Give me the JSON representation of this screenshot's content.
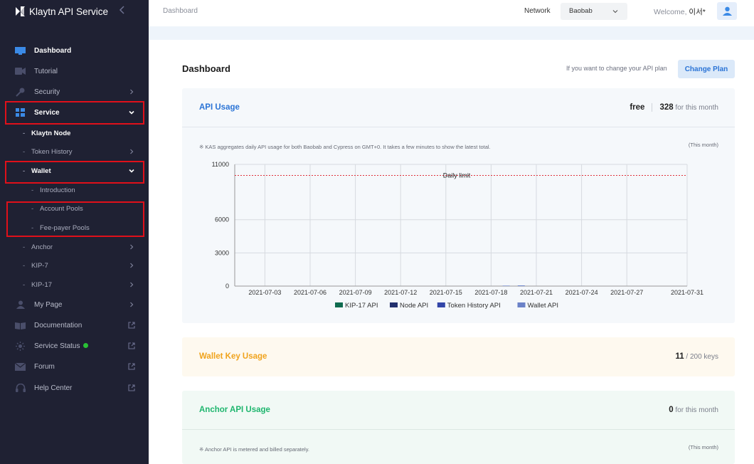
{
  "sidebar": {
    "brand": "Klaytn API Service",
    "items": [
      {
        "label": "Dashboard",
        "icon": "dashboard-icon"
      },
      {
        "label": "Tutorial",
        "icon": "video-icon"
      },
      {
        "label": "Security",
        "icon": "key-icon"
      },
      {
        "label": "Service",
        "icon": "grid-icon"
      },
      {
        "label": "My Page",
        "icon": "user-icon"
      },
      {
        "label": "Documentation",
        "icon": "book-icon"
      },
      {
        "label": "Service Status",
        "icon": "status-icon"
      },
      {
        "label": "Forum",
        "icon": "mail-icon"
      },
      {
        "label": "Help Center",
        "icon": "headset-icon"
      }
    ],
    "service_items": [
      {
        "label": "Klaytn Node"
      },
      {
        "label": "Token History"
      },
      {
        "label": "Wallet"
      },
      {
        "label": "Introduction"
      },
      {
        "label": "Account Pools"
      },
      {
        "label": "Fee-payer Pools"
      },
      {
        "label": "Anchor"
      },
      {
        "label": "KIP-7"
      },
      {
        "label": "KIP-17"
      }
    ],
    "status_color": "#29c135",
    "highlight_color": "#e0101a"
  },
  "topbar": {
    "breadcrumb": "Dashboard",
    "network_label": "Network",
    "network_value": "Baobab",
    "welcome_prefix": "Welcome,",
    "user_name": "이서*"
  },
  "main": {
    "title": "Dashboard",
    "plan_hint": "If you want to change your API plan",
    "change_plan": "Change Plan",
    "api_usage": {
      "title": "API Usage",
      "plan": "free",
      "count": "328",
      "count_suffix": "for this month",
      "note": "※ KAS aggregates daily API usage for both Baobab and Cypress on GMT+0. It takes a few minutes to show the latest total.",
      "period": "(This month)"
    },
    "wallet_key_usage": {
      "title": "Wallet Key Usage",
      "count": "11",
      "suffix": "/ 200 keys"
    },
    "anchor_api_usage": {
      "title": "Anchor API Usage",
      "count": "0",
      "suffix": "for this month",
      "note": "※ Anchor API is metered and billed separately.",
      "period": "(This month)"
    },
    "colors": {
      "api_title": "#2b74d6",
      "wallet_title": "#f0a31c",
      "anchor_title": "#1eb66e"
    }
  },
  "chart_data": {
    "type": "bar",
    "x": [
      "2021-07-03",
      "2021-07-06",
      "2021-07-09",
      "2021-07-12",
      "2021-07-15",
      "2021-07-18",
      "2021-07-21",
      "2021-07-24",
      "2021-07-27",
      "2021-07-31"
    ],
    "xlim": [
      "2021-07-01",
      "2021-07-31"
    ],
    "ylim": [
      0,
      11000
    ],
    "yticks": [
      0,
      3000,
      6000,
      11000
    ],
    "daily_limit": 10000,
    "daily_limit_label": "Daily limit",
    "series": [
      {
        "name": "KIP-17 API",
        "color": "#0f6b4f"
      },
      {
        "name": "Node API",
        "color": "#23306e"
      },
      {
        "name": "Token History API",
        "color": "#3346a8"
      },
      {
        "name": "Wallet API",
        "color": "#6b82c8"
      }
    ],
    "bars": [
      {
        "x": "2021-07-19",
        "value": 40
      },
      {
        "x": "2021-07-20",
        "value": 60
      }
    ],
    "grid": true,
    "legend_position": "bottom"
  }
}
